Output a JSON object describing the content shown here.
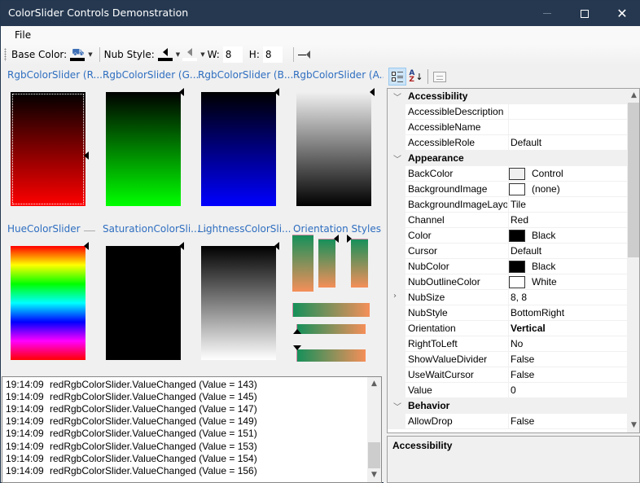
{
  "window": {
    "title": "ColorSlider Controls Demonstration",
    "controls": {
      "minimize": "minimize-icon",
      "maximize": "maximize-icon",
      "close": "close-icon"
    }
  },
  "menu": {
    "items": [
      {
        "label": "File"
      }
    ]
  },
  "toolbar": {
    "base_color_label": "Base Color:",
    "base_color_value": "#000000",
    "nub_style_label": "Nub Style:",
    "nub_color_1": "#000000",
    "nub_color_2": "#ffffff",
    "width_label": "W:",
    "width_value": "8",
    "height_label": "H:",
    "height_value": "8",
    "show_divider_icon": "value-divider-icon"
  },
  "sliders": {
    "groups": [
      {
        "label": "RgbColorSlider (R...",
        "gradient": [
          "#000000",
          "#ff0000"
        ],
        "nub_position": 0.56,
        "focused": true
      },
      {
        "label": "RgbColorSlider (G...",
        "gradient": [
          "#000000",
          "#00ff00"
        ],
        "nub_position": 0.0,
        "focused": false
      },
      {
        "label": "RgbColorSlider (B...",
        "gradient": [
          "#000000",
          "#0000ff"
        ],
        "nub_position": 0.0,
        "focused": false
      },
      {
        "label": "RgbColorSlider (A...",
        "gradient": [
          "#f0f0f0",
          "#000000"
        ],
        "nub_position": 0.0,
        "focused": false
      },
      {
        "label": "HueColorSlider",
        "gradient": [
          "#ff0000",
          "#ffff00",
          "#00ff00",
          "#00ffff",
          "#0000ff",
          "#ff00ff",
          "#ff0000"
        ],
        "nub_position": 0.0,
        "focused": false
      },
      {
        "label": "SaturationColorSli...",
        "gradient": [
          "#000000",
          "#000000"
        ],
        "nub_position": 0.0,
        "focused": false
      },
      {
        "label": "LightnessColorSli...",
        "gradient": [
          "#000000",
          "#ffffff"
        ],
        "nub_position": 0.0,
        "focused": false
      },
      {
        "label": "Orientation Styles",
        "gradient": [
          "#16905a",
          "#f58f59"
        ],
        "nub_position": 0.0,
        "focused": false
      }
    ]
  },
  "log": {
    "entries": [
      {
        "time": "19:14:09",
        "message": "redRgbColorSlider.ValueChanged (Value = 143)"
      },
      {
        "time": "19:14:09",
        "message": "redRgbColorSlider.ValueChanged (Value = 145)"
      },
      {
        "time": "19:14:09",
        "message": "redRgbColorSlider.ValueChanged (Value = 147)"
      },
      {
        "time": "19:14:09",
        "message": "redRgbColorSlider.ValueChanged (Value = 149)"
      },
      {
        "time": "19:14:09",
        "message": "redRgbColorSlider.ValueChanged (Value = 151)"
      },
      {
        "time": "19:14:09",
        "message": "redRgbColorSlider.ValueChanged (Value = 153)"
      },
      {
        "time": "19:14:09",
        "message": "redRgbColorSlider.ValueChanged (Value = 154)"
      },
      {
        "time": "19:14:09",
        "message": "redRgbColorSlider.ValueChanged (Value = 156)"
      }
    ]
  },
  "property_grid": {
    "toolbar": {
      "categorized": "categorized-icon",
      "alphabetical": "alphabetical-icon",
      "property_pages": "property-pages-icon"
    },
    "rows": [
      {
        "type": "category",
        "name": "Accessibility",
        "expanded": true
      },
      {
        "type": "prop",
        "name": "AccessibleDescription",
        "value": ""
      },
      {
        "type": "prop",
        "name": "AccessibleName",
        "value": ""
      },
      {
        "type": "prop",
        "name": "AccessibleRole",
        "value": "Default"
      },
      {
        "type": "category",
        "name": "Appearance",
        "expanded": true
      },
      {
        "type": "prop",
        "name": "BackColor",
        "value": "Control",
        "swatch": "#f0f0f0"
      },
      {
        "type": "prop",
        "name": "BackgroundImage",
        "value": "(none)",
        "swatch": "#ffffff"
      },
      {
        "type": "prop",
        "name": "BackgroundImageLayout",
        "value": "Tile"
      },
      {
        "type": "prop",
        "name": "Channel",
        "value": "Red"
      },
      {
        "type": "prop",
        "name": "Color",
        "value": "Black",
        "swatch": "#000000"
      },
      {
        "type": "prop",
        "name": "Cursor",
        "value": "Default"
      },
      {
        "type": "prop",
        "name": "NubColor",
        "value": "Black",
        "swatch": "#000000"
      },
      {
        "type": "prop",
        "name": "NubOutlineColor",
        "value": "White",
        "swatch": "#ffffff"
      },
      {
        "type": "prop",
        "name": "NubSize",
        "value": "8, 8",
        "expandable": true
      },
      {
        "type": "prop",
        "name": "NubStyle",
        "value": "BottomRight"
      },
      {
        "type": "prop",
        "name": "Orientation",
        "value": "Vertical",
        "bold": true
      },
      {
        "type": "prop",
        "name": "RightToLeft",
        "value": "No"
      },
      {
        "type": "prop",
        "name": "ShowValueDivider",
        "value": "False"
      },
      {
        "type": "prop",
        "name": "UseWaitCursor",
        "value": "False"
      },
      {
        "type": "prop",
        "name": "Value",
        "value": "0"
      },
      {
        "type": "category",
        "name": "Behavior",
        "expanded": true
      },
      {
        "type": "prop",
        "name": "AllowDrop",
        "value": "False"
      }
    ],
    "help_title": "Accessibility",
    "help_description": ""
  }
}
